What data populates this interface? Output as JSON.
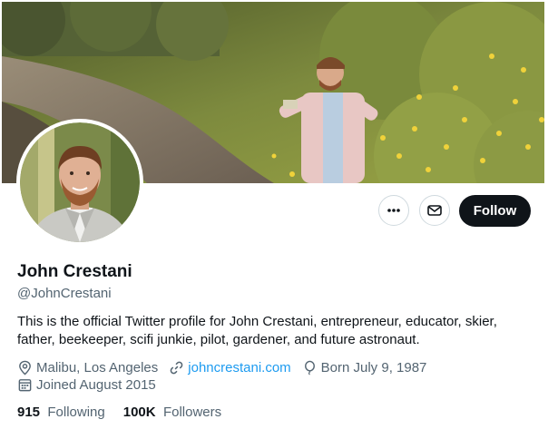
{
  "profile": {
    "name": "John Crestani",
    "handle": "@JohnCrestani",
    "bio": "This is the official Twitter profile for John Crestani, entrepreneur, educator, skier, father, beekeeper, scifi junkie, pilot, gardener, and future astronaut.",
    "location": "Malibu, Los Angeles",
    "website": "johncrestani.com",
    "birthday": "Born July 9, 1987",
    "joined": "Joined August 2015"
  },
  "stats": {
    "following_count": "915",
    "following_label": "Following",
    "followers_count": "100K",
    "followers_label": "Followers"
  },
  "actions": {
    "follow_label": "Follow"
  },
  "icons": {
    "more": "more-icon",
    "message": "message-icon",
    "location": "location-icon",
    "link": "link-icon",
    "birthday": "balloon-icon",
    "calendar": "calendar-icon"
  },
  "colors": {
    "text": "#0f1419",
    "secondary": "#536471",
    "link": "#1d9bf0",
    "button_dark": "#0f1419",
    "border": "#cfd9de"
  }
}
